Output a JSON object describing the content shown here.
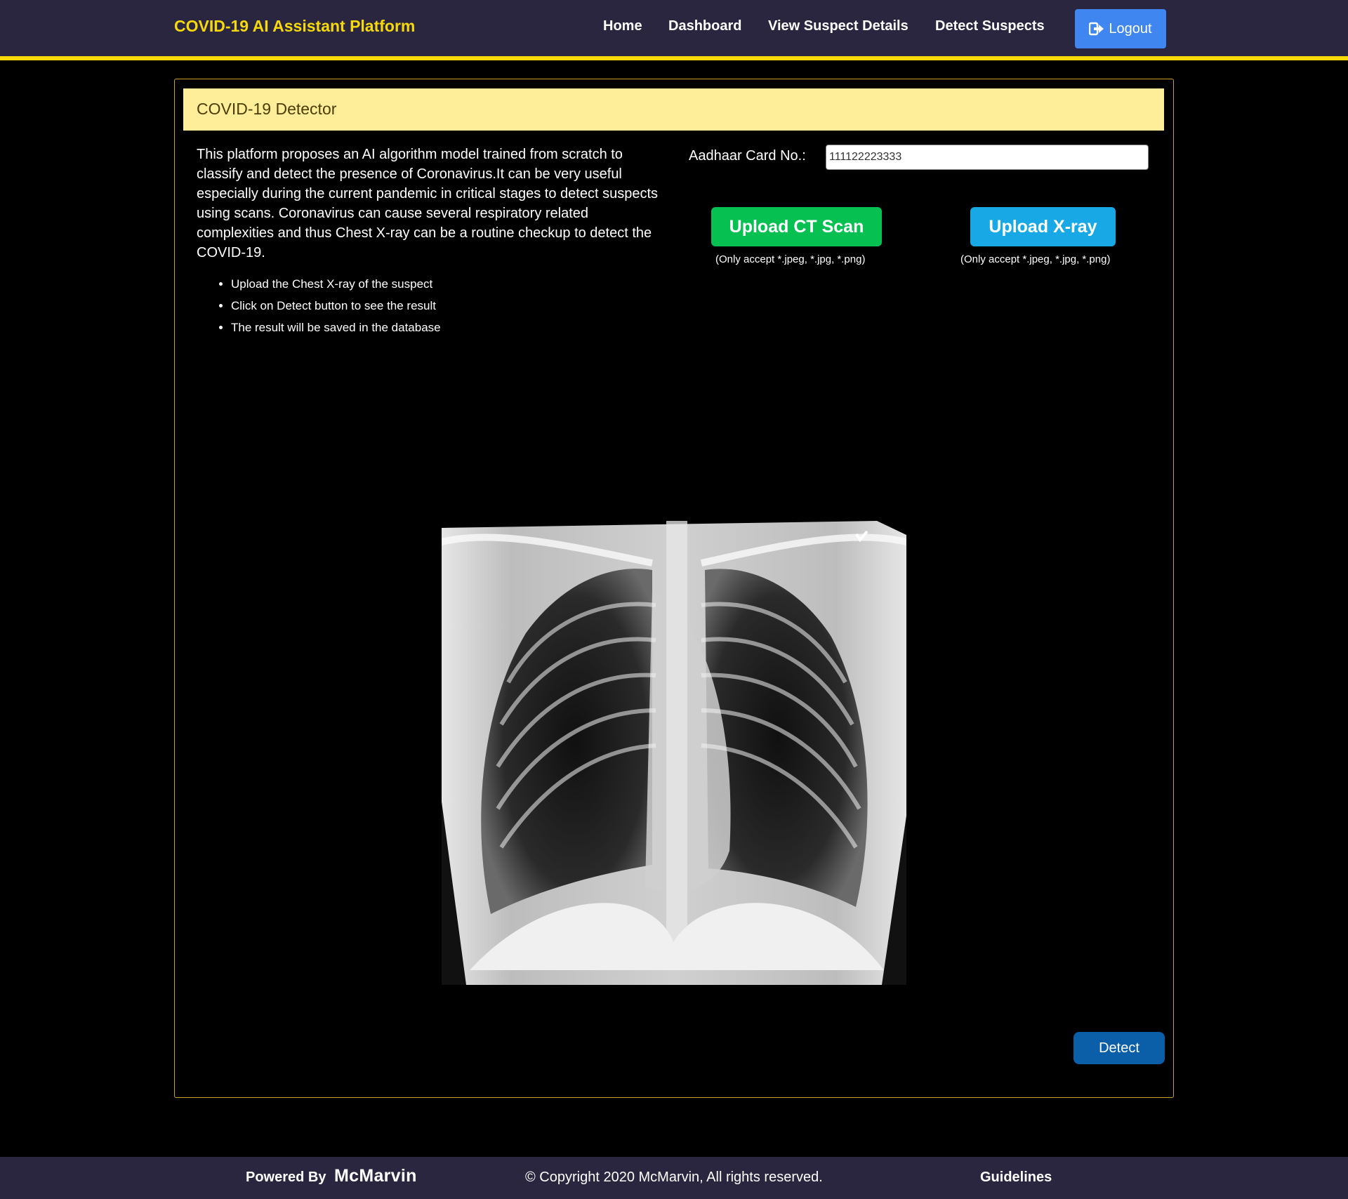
{
  "navbar": {
    "brand": "COVID-19 AI Assistant Platform",
    "links": [
      "Home",
      "Dashboard",
      "View Suspect Details",
      "Detect Suspects"
    ],
    "logout_label": "Logout",
    "accent": "#f5d90a",
    "background": "#2a2640",
    "logout_icon": "sign-out-icon"
  },
  "card": {
    "title": "COVID-19 Detector",
    "description": "This platform proposes an AI algorithm model trained from scratch to classify and detect the presence of Coronavirus.It can be very useful especially during the current pandemic in critical stages to detect suspects using scans. Coronavirus can cause several respiratory related complexities and thus Chest X-ray can be a routine checkup to detect the COVID-19.",
    "steps": [
      "Upload the Chest X-ray of the suspect",
      "Click on Detect button to see the result",
      "The result will be saved in the database"
    ],
    "aadhaar": {
      "label": "Aadhaar Card No.:",
      "value": "111122223333"
    },
    "upload_ct": {
      "label": "Upload CT Scan",
      "hint": "(Only accept *.jpeg, *.jpg, *.png)",
      "color": "#06c152"
    },
    "upload_xray": {
      "label": "Upload X-ray",
      "hint": "(Only accept *.jpeg, *.jpg, *.png)",
      "color": "#19a8e6"
    },
    "detect_label": "Detect"
  },
  "footer": {
    "powered_by": "Powered By",
    "brand": "McMarvin",
    "copyright": "© Copyright 2020 McMarvin, All rights reserved.",
    "guidelines": "Guidelines"
  }
}
